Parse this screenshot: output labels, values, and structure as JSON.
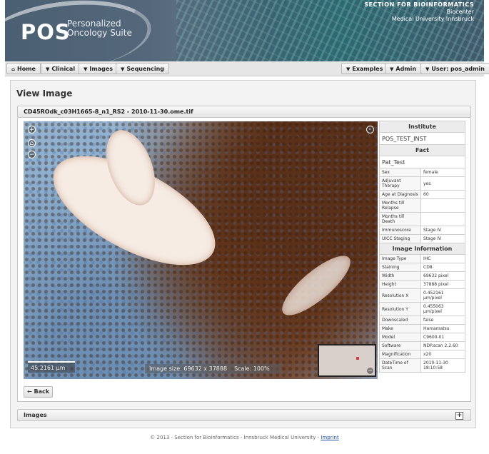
{
  "header": {
    "logo_mark": "POS",
    "logo_text": "Personalized Oncology Suite",
    "org_line1": "SECTION FOR BIOINFORMATICS",
    "org_line2": "Biocenter",
    "org_line3": "Medical University Innsbruck"
  },
  "nav": {
    "home": "Home",
    "clinical": "Clinical",
    "images": "Images",
    "sequencing": "Sequencing",
    "examples": "Examples",
    "admin": "Admin",
    "user": "User: pos_admin"
  },
  "page": {
    "title": "View Image",
    "image_name": "CD45ROdk_c03H1665-8_n1_RS2 - 2010-11-30.ome.tif"
  },
  "viewer": {
    "scale_bar": "45.2161 μm",
    "image_size": "Image size: 69632 x 37888",
    "scale": "Scale: 100%"
  },
  "institute": {
    "header": "Institute",
    "value": "POS_TEST_INST"
  },
  "fact": {
    "header": "Fact",
    "patient": "Pat_Test",
    "rows": [
      {
        "key": "Sex",
        "value": "female"
      },
      {
        "key": "Adjuvant Therapy",
        "value": "yes"
      },
      {
        "key": "Age at Diagnosis",
        "value": "60"
      },
      {
        "key": "Months till Relapse",
        "value": ""
      },
      {
        "key": "Months till Death",
        "value": ""
      },
      {
        "key": "Immunoscore",
        "value": "Stage IV"
      },
      {
        "key": "UICC Staging",
        "value": "Stage IV"
      }
    ]
  },
  "image_info": {
    "header": "Image Information",
    "rows": [
      {
        "key": "Image Type",
        "value": "IHC"
      },
      {
        "key": "Staining",
        "value": "CD8"
      },
      {
        "key": "Width",
        "value": "69632 pixel"
      },
      {
        "key": "Height",
        "value": "37888 pixel"
      },
      {
        "key": "Resolution X",
        "value": "0.452161 μm/pixel"
      },
      {
        "key": "Resolution Y",
        "value": "0.455063 μm/pixel"
      },
      {
        "key": "Downscaled",
        "value": "false"
      },
      {
        "key": "Make",
        "value": "Hamamatsu"
      },
      {
        "key": "Model",
        "value": "C9600-01"
      },
      {
        "key": "Software",
        "value": "NDP.scan 2.2.60"
      },
      {
        "key": "Magnification",
        "value": "x20"
      },
      {
        "key": "DateTime of Scan",
        "value": "2010-11-30 18:10:58"
      }
    ]
  },
  "actions": {
    "back": "Back"
  },
  "images_section": {
    "label": "Images"
  },
  "footer": {
    "text": "© 2013 - Section for Bioinformatics - Innsbruck Medical University - ",
    "link": "Imprint"
  }
}
